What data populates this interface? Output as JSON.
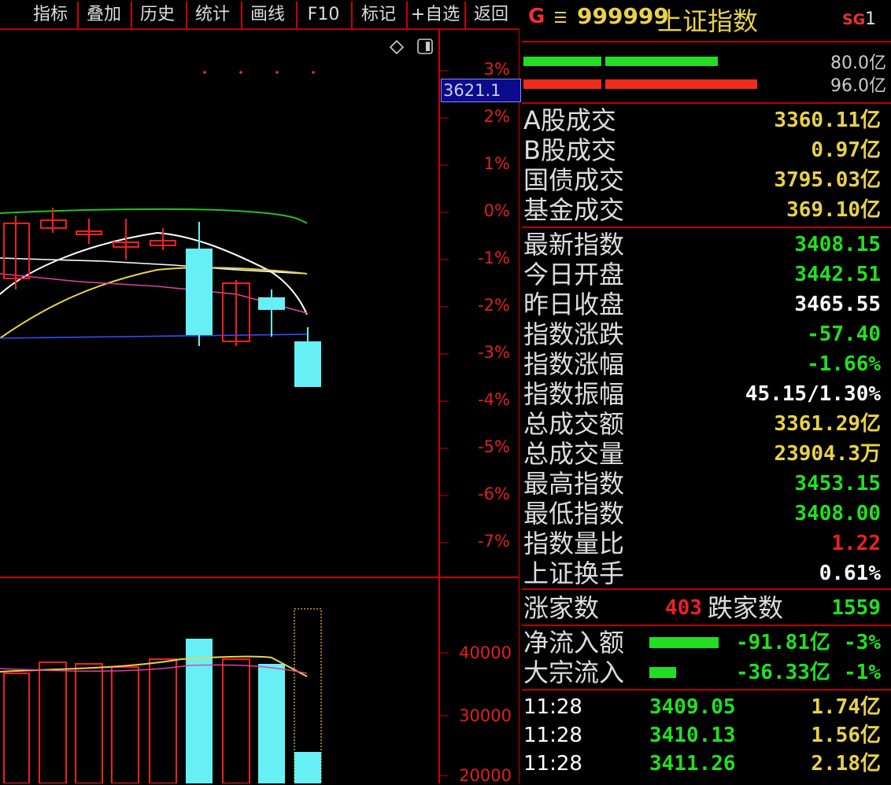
{
  "menu": [
    "指标",
    "叠加",
    "历史",
    "统计",
    "画线",
    "F10",
    "标记",
    "+自选",
    "返回"
  ],
  "chart_icons": {
    "diamond": "diamond-icon",
    "window": "window-icon"
  },
  "price_tag": "3621.1",
  "pct_axis": [
    "3%",
    "2%",
    "1%",
    "0%",
    "-1%",
    "-2%",
    "-3%",
    "-4%",
    "-5%",
    "-6%",
    "-7%"
  ],
  "vol_axis": [
    "40000",
    "30000",
    "20000"
  ],
  "header": {
    "g": "G",
    "menu_icon": "hamburger-icon",
    "code": "999999",
    "name": "上证指数",
    "sg": "SG",
    "sg_num": "1"
  },
  "bars": [
    {
      "color": "#22dd22",
      "pct": "80.0亿"
    },
    {
      "color": "#ee2b1d",
      "pct": "96.0亿"
    }
  ],
  "turnover": [
    {
      "label": "A股成交",
      "value": "3360.11亿"
    },
    {
      "label": "B股成交",
      "value": "0.97亿"
    },
    {
      "label": "国债成交",
      "value": "3795.03亿"
    },
    {
      "label": "基金成交",
      "value": "369.10亿"
    }
  ],
  "stats": [
    {
      "label": "最新指数",
      "value": "3408.15",
      "color": "#22e022"
    },
    {
      "label": "今日开盘",
      "value": "3442.51",
      "color": "#22e022"
    },
    {
      "label": "昨日收盘",
      "value": "3465.55",
      "color": "#ffffff"
    },
    {
      "label": "指数涨跌",
      "value": "-57.40",
      "color": "#22e022"
    },
    {
      "label": "指数涨幅",
      "value": "-1.66%",
      "color": "#22e022"
    },
    {
      "label": "指数振幅",
      "value": "45.15/1.30%",
      "color": "#ffffff"
    },
    {
      "label": "总成交额",
      "value": "3361.29亿",
      "color": "#e8d24a"
    },
    {
      "label": "总成交量",
      "value": "23904.3万",
      "color": "#e8d24a"
    },
    {
      "label": "最高指数",
      "value": "3453.15",
      "color": "#22e022"
    },
    {
      "label": "最低指数",
      "value": "3408.00",
      "color": "#22e022"
    },
    {
      "label": "指数量比",
      "value": "1.22",
      "color": "#ee2020"
    },
    {
      "label": "上证换手",
      "value": "0.61%",
      "color": "#ffffff"
    }
  ],
  "breadth": {
    "up_label": "涨家数",
    "up_value": "403",
    "down_label": "跌家数",
    "down_value": "1559"
  },
  "flows": [
    {
      "label": "净流入额",
      "value": "-91.81亿",
      "pct": "-3%",
      "bar": 0.9
    },
    {
      "label": "大宗流入",
      "value": "-36.33亿",
      "pct": "-1%",
      "bar": 0.35
    }
  ],
  "ticks": [
    {
      "time": "11:28",
      "price": "3409.05",
      "amount": "1.74亿"
    },
    {
      "time": "11:28",
      "price": "3410.13",
      "amount": "1.56亿"
    },
    {
      "time": "11:28",
      "price": "3411.26",
      "amount": "2.18亿"
    }
  ],
  "colors": {
    "up": "#ee2020",
    "down": "#66f0f6",
    "accent": "#e8d24a",
    "grid": "#b00000"
  }
}
